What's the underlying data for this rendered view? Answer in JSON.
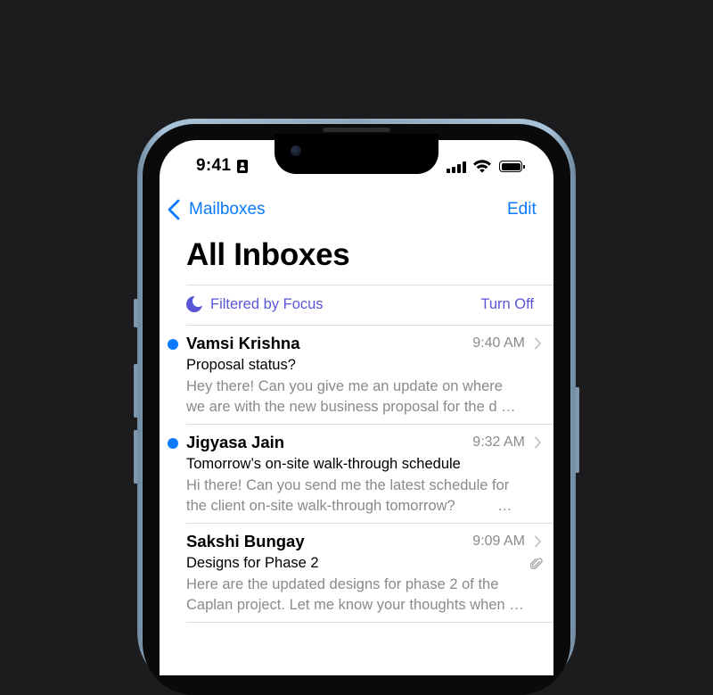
{
  "status_bar": {
    "time": "9:41"
  },
  "nav": {
    "back_label": "Mailboxes",
    "edit_label": "Edit"
  },
  "title": "All Inboxes",
  "focus": {
    "label": "Filtered by Focus",
    "action": "Turn Off"
  },
  "messages": [
    {
      "sender": "Vamsi Krishna",
      "time": "9:40 AM",
      "subject": "Proposal status?",
      "preview_line1": "Hey there! Can you give me an update on where",
      "preview_line2": "we are with the new business proposal for the d …",
      "unread": true,
      "attachment": false
    },
    {
      "sender": "Jigyasa Jain",
      "time": "9:32 AM",
      "subject": "Tomorrow’s on-site walk-through schedule",
      "preview_line1": "Hi there! Can you send me the latest schedule for",
      "preview_line2": "the client on-site walk-through tomorrow?",
      "preview_ellipsis": "…",
      "unread": true,
      "attachment": false
    },
    {
      "sender": "Sakshi Bungay",
      "time": "9:09 AM",
      "subject": "Designs for Phase 2",
      "preview_line1": "Here are the updated designs for phase 2 of the",
      "preview_line2": "Caplan project. Let me know your thoughts when …",
      "unread": false,
      "attachment": true
    }
  ],
  "colors": {
    "accent": "#0a7aff",
    "focus": "#5856d6",
    "secondary_text": "#8a8a8e",
    "background": "#1c1c1e"
  },
  "icons": [
    "id-card-icon",
    "signal-icon",
    "wifi-icon",
    "battery-icon",
    "chevron-left-icon",
    "moon-icon",
    "chevron-right-icon",
    "paperclip-icon"
  ]
}
